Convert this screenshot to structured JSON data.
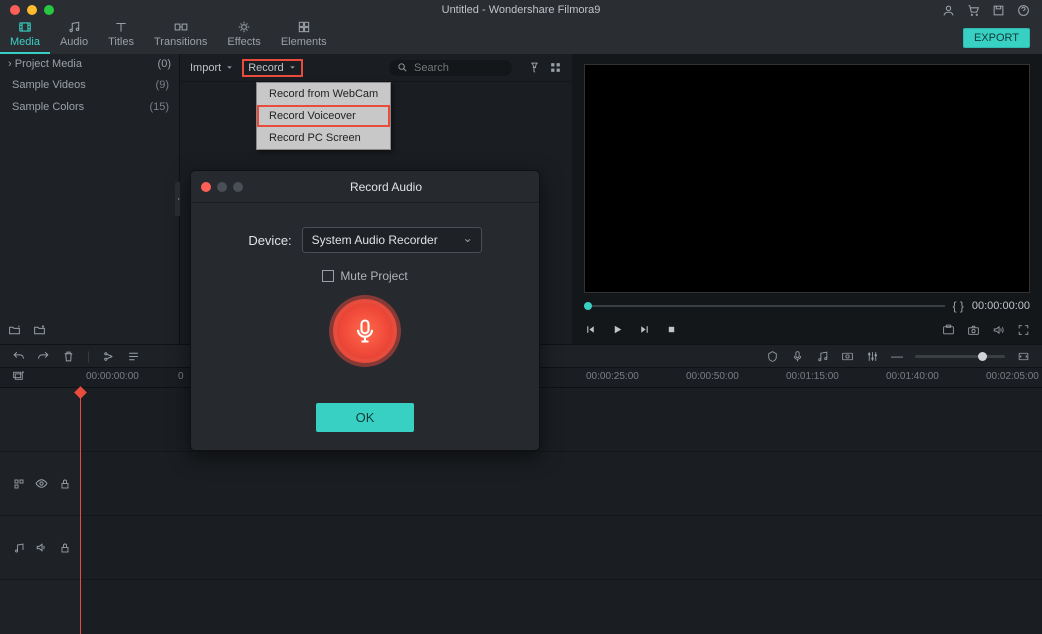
{
  "window": {
    "title": "Untitled - Wondershare Filmora9"
  },
  "tabs": {
    "items": [
      {
        "label": "Media",
        "active": true
      },
      {
        "label": "Audio"
      },
      {
        "label": "Titles"
      },
      {
        "label": "Transitions"
      },
      {
        "label": "Effects"
      },
      {
        "label": "Elements"
      }
    ],
    "export": "EXPORT"
  },
  "sidebar": {
    "header": "Project Media",
    "header_count": "(0)",
    "items": [
      {
        "label": "Sample Videos",
        "count": "(9)"
      },
      {
        "label": "Sample Colors",
        "count": "(15)"
      }
    ]
  },
  "media_panel": {
    "import": "Import",
    "record": "Record",
    "search_placeholder": "Search",
    "dropdown": {
      "item1": "Record from WebCam",
      "item2": "Record Voiceover",
      "item3": "Record PC Screen"
    }
  },
  "preview": {
    "time_display": "00:00:00:00"
  },
  "timeline": {
    "ticks": [
      "00:00:00:00",
      "0",
      "00:00:25:00",
      "00:00:50:00",
      "00:01:15:00",
      "00:01:40:00",
      "00:02:05:00"
    ]
  },
  "modal": {
    "title": "Record Audio",
    "device_label": "Device:",
    "device_value": "System Audio Recorder",
    "mute_label": "Mute Project",
    "ok": "OK"
  }
}
